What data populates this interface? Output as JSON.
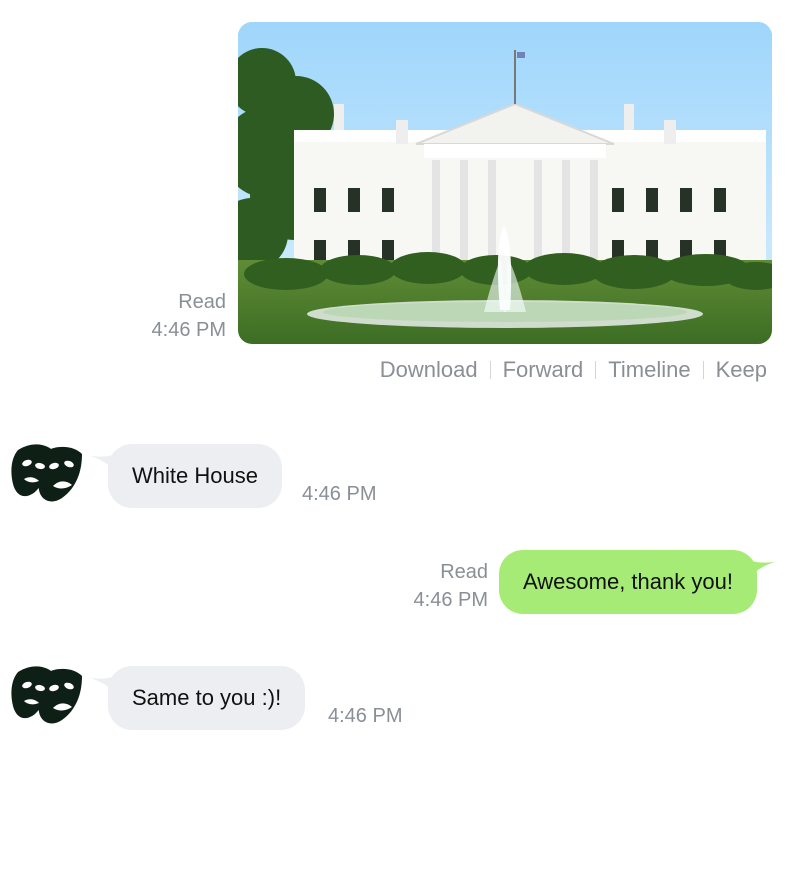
{
  "messages": [
    {
      "kind": "photo",
      "photo_alt": "White House",
      "status": "Read",
      "time": "4:46 PM",
      "actions": [
        "Download",
        "Forward",
        "Timeline",
        "Keep"
      ]
    },
    {
      "kind": "incoming",
      "text": "White House",
      "time": "4:46 PM",
      "avatar_icon": "theater-masks-icon"
    },
    {
      "kind": "outgoing",
      "text": "Awesome, thank you!",
      "status": "Read",
      "time": "4:46 PM"
    },
    {
      "kind": "incoming",
      "text": "Same to you :)!",
      "time": "4:46 PM",
      "avatar_icon": "theater-masks-icon"
    }
  ],
  "colors": {
    "incoming_bubble": "#eceef1",
    "outgoing_bubble": "#a6eb76",
    "meta_text": "#8a8f96"
  }
}
